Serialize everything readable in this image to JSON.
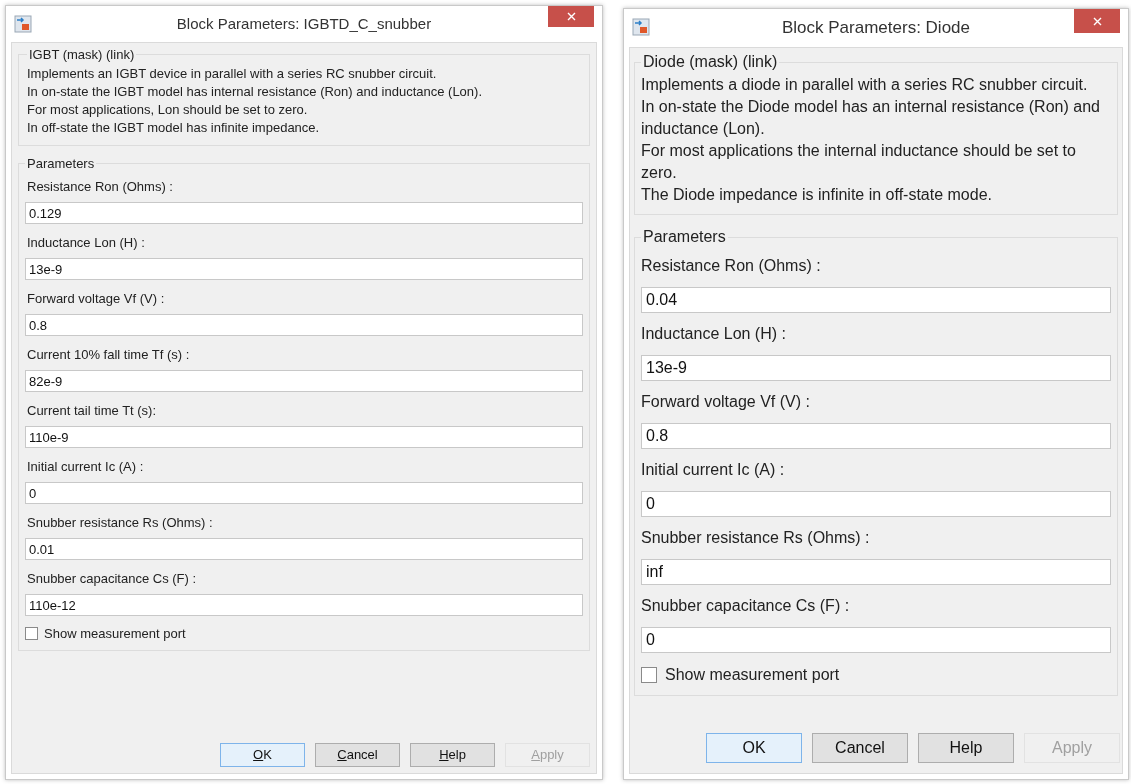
{
  "dialogs": [
    {
      "title": "Block Parameters: IGBTD_C_snubber",
      "underlined_mnemonics": true,
      "description": {
        "heading": "IGBT (mask) (link)",
        "lines": [
          "Implements an IGBT device  in parallel with a series RC snubber circuit.",
          "In on-state the IGBT model has internal resistance (Ron) and inductance (Lon).",
          "For most applications, Lon should be set to zero.",
          "In off-state the IGBT model has infinite impedance."
        ]
      },
      "parameters": {
        "heading": "Parameters",
        "fields": [
          {
            "label": "Resistance Ron (Ohms) :",
            "value": "0.129"
          },
          {
            "label": "Inductance Lon (H) :",
            "value": "13e-9"
          },
          {
            "label": "Forward voltage Vf (V) :",
            "value": "0.8"
          },
          {
            "label": "Current 10% fall time Tf (s) :",
            "value": "82e-9"
          },
          {
            "label": "Current tail time Tt (s):",
            "value": "110e-9"
          },
          {
            "label": "Initial current Ic (A) :",
            "value": "0"
          },
          {
            "label": "Snubber resistance Rs (Ohms) :",
            "value": "0.01"
          },
          {
            "label": "Snubber capacitance Cs (F) :",
            "value": "110e-12"
          }
        ],
        "checkbox": {
          "label": "Show measurement port",
          "checked": false
        }
      },
      "buttons": [
        {
          "label": "OK",
          "default": true,
          "disabled": false
        },
        {
          "label": "Cancel",
          "default": false,
          "disabled": false
        },
        {
          "label": "Help",
          "default": false,
          "disabled": false
        },
        {
          "label": "Apply",
          "default": false,
          "disabled": true
        }
      ]
    },
    {
      "title": "Block Parameters: Diode",
      "underlined_mnemonics": false,
      "description": {
        "heading": "Diode (mask) (link)",
        "lines": [
          "Implements a diode in parallel with a series RC snubber circuit.",
          "In on-state the Diode model has an internal resistance (Ron) and inductance (Lon).",
          "For most applications the internal inductance should be set to zero.",
          "The Diode impedance is infinite in off-state mode."
        ]
      },
      "parameters": {
        "heading": "Parameters",
        "fields": [
          {
            "label": "Resistance Ron (Ohms) :",
            "value": "0.04"
          },
          {
            "label": "Inductance Lon (H) :",
            "value": "13e-9"
          },
          {
            "label": "Forward voltage Vf (V) :",
            "value": "0.8"
          },
          {
            "label": "Initial current Ic (A) :",
            "value": "0"
          },
          {
            "label": "Snubber resistance Rs (Ohms) :",
            "value": "inf"
          },
          {
            "label": "Snubber capacitance Cs (F) :",
            "value": "0"
          }
        ],
        "checkbox": {
          "label": "Show measurement port",
          "checked": false
        }
      },
      "buttons": [
        {
          "label": "OK",
          "default": true,
          "disabled": false
        },
        {
          "label": "Cancel",
          "default": false,
          "disabled": false
        },
        {
          "label": "Help",
          "default": false,
          "disabled": false
        },
        {
          "label": "Apply",
          "default": false,
          "disabled": true
        }
      ]
    }
  ]
}
